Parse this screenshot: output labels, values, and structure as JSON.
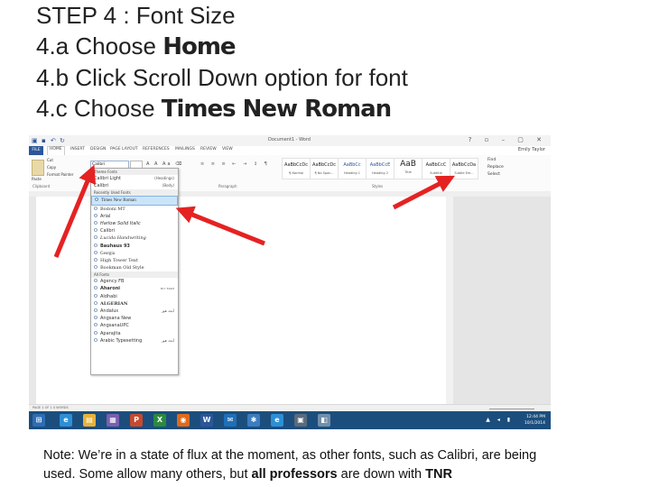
{
  "title": {
    "line1": "STEP 4 : Font Size",
    "line2_prefix": "4.a Choose ",
    "line2_bold": "Home",
    "line3": "4.b Click Scroll Down option for font",
    "line4_prefix": "4.c Choose ",
    "line4_bold": "Times New Roman"
  },
  "word": {
    "doc_title": "Document1 - Word",
    "user": "Emily Taylor",
    "tabs": [
      "FILE",
      "HOME",
      "INSERT",
      "DESIGN",
      "PAGE LAYOUT",
      "REFERENCES",
      "MAILINGS",
      "REVIEW",
      "VIEW"
    ],
    "clipboard": {
      "paste": "Paste",
      "cut": "Cut",
      "copy": "Copy",
      "format_painter": "Format Painter",
      "group": "Clipboard"
    },
    "font_box_value": "Calibri",
    "groups": {
      "paragraph": "Paragraph",
      "styles": "Styles"
    },
    "styles": [
      {
        "sample": "AaBbCcDc",
        "name": "¶ Normal"
      },
      {
        "sample": "AaBbCcDc",
        "name": "¶ No Spac..."
      },
      {
        "sample": "AaBbCc",
        "name": "Heading 1"
      },
      {
        "sample": "AaBbCcE",
        "name": "Heading 2"
      },
      {
        "sample": "AaB",
        "name": "Title"
      },
      {
        "sample": "AaBbCcC",
        "name": "Subtitle"
      },
      {
        "sample": "AaBbCcDa",
        "name": "Subtle Em..."
      }
    ],
    "editing": {
      "find": "Find",
      "replace": "Replace",
      "select": "Select"
    },
    "status_text": "PAGE 1 OF 1   0 WORDS",
    "clock": {
      "time": "12:44 PM",
      "date": "10/1/2014"
    }
  },
  "fontlist": {
    "sections": {
      "theme": "Theme Fonts",
      "recent": "Recently Used Fonts",
      "all": "All Fonts"
    },
    "theme": [
      {
        "name": "Calibri Light",
        "role": "(Headings)"
      },
      {
        "name": "Calibri",
        "role": "(Body)"
      }
    ],
    "recent": [
      "Times New Roman",
      "Bodoni MT",
      "Arial",
      "Harlow Solid Italic",
      "Calibri",
      "Lucida Handwriting",
      "Bauhaus 93",
      "Georgia",
      "High Tower Text",
      "Bookman Old Style"
    ],
    "all": [
      {
        "name": "Agency FB",
        "sample": ""
      },
      {
        "name": "Aharoni",
        "sample": "אבגד הוז"
      },
      {
        "name": "Aldhabi",
        "sample": ""
      },
      {
        "name": "ALGERIAN",
        "sample": ""
      },
      {
        "name": "Andalus",
        "sample": "أبجد هوز"
      },
      {
        "name": "Angsana New",
        "sample": ""
      },
      {
        "name": "AngsanaUPC",
        "sample": ""
      },
      {
        "name": "Aparajita",
        "sample": ""
      },
      {
        "name": "Arabic Typesetting",
        "sample": "أبجد هوز"
      }
    ]
  },
  "note": {
    "line1": "Note: We’re in a state of flux at the moment, as other fonts, such as Calibri, are being",
    "line2_prefix": "used. Some allow many others, but ",
    "line2_bold1": "all professors",
    "line2_mid": " are down with ",
    "line2_bold2": "TNR"
  },
  "colors": {
    "ribbon_blue": "#2b579a",
    "arrow_red": "#e52222",
    "taskbar": "#1c4e7d"
  }
}
